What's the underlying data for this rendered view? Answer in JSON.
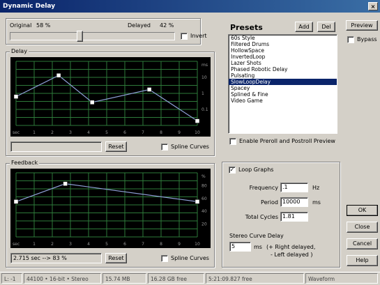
{
  "window": {
    "title": "Dynamic Delay",
    "close_glyph": "×"
  },
  "mix": {
    "original_label": "Original",
    "original_value": "58 %",
    "delayed_label": "Delayed",
    "delayed_value": "42 %",
    "invert_label": "Invert",
    "invert_checked": false,
    "slider_level": 0.42
  },
  "delay": {
    "title": "Delay",
    "reset_label": "Reset",
    "spline_label": "Spline Curves",
    "unit_label": "ms",
    "y_ticks": [
      "10",
      "1",
      "0.1"
    ],
    "x_prefix": "sec",
    "x_ticks": [
      "1",
      "2",
      "3",
      "4",
      "5",
      "6",
      "7",
      "8",
      "9",
      "10"
    ],
    "status_text": ""
  },
  "feedback": {
    "title": "Feedback",
    "reset_label": "Reset",
    "spline_label": "Spline Curves",
    "unit_label": "%",
    "y_ticks": [
      "80",
      "60",
      "40",
      "20"
    ],
    "x_prefix": "sec",
    "x_ticks": [
      "1",
      "2",
      "3",
      "4",
      "5",
      "6",
      "7",
      "8",
      "9",
      "10"
    ],
    "status_text": "2.715 sec --> 83 %"
  },
  "presets": {
    "title": "Presets",
    "add_label": "Add",
    "del_label": "Del",
    "items": [
      "60s Style",
      "Filtered Drums",
      "HollowSpace",
      "InvertedLoop",
      "Lazer Shots",
      "Phased Robotic Delay",
      "Pulsating",
      "SlowLoopDelay",
      "Spacey",
      "Splined & Fine",
      "Video Game"
    ],
    "selected": "SlowLoopDelay",
    "preroll_label": "Enable Preroll and Postroll Preview"
  },
  "side": {
    "preview_label": "Preview",
    "bypass_label": "Bypass",
    "ok_label": "OK",
    "close_label": "Close",
    "cancel_label": "Cancel",
    "help_label": "Help"
  },
  "loop": {
    "loop_graphs_label": "Loop Graphs",
    "loop_graphs_checked": true,
    "check_glyph": "✓",
    "frequency_label": "Frequency",
    "frequency_value": ".1",
    "frequency_unit": "Hz",
    "period_label": "Period",
    "period_value": "10000",
    "period_unit": "ms",
    "cycles_label": "Total Cycles",
    "cycles_value": "1.81",
    "stereo_label": "Stereo Curve Delay",
    "stereo_value": "5",
    "stereo_unit": "ms",
    "stereo_note1": "(+ Right delayed,",
    "stereo_note2": "- Left delayed )"
  },
  "status": [
    "L: -1",
    "44100 • 16-bit • Stereo",
    "15.74 MB",
    "16.28 GB free",
    "5:21:09.827 free",
    "Waveform"
  ],
  "colors": {
    "graph_bg": "#000000",
    "grid": "#2e7a3a",
    "curve": "#8fa0d8",
    "handle": "#ffffff"
  },
  "delay_curve": [
    {
      "t": 0,
      "v": 0.45
    },
    {
      "t": 2.35,
      "v": 0.78
    },
    {
      "t": 4.2,
      "v": 0.36
    },
    {
      "t": 7.35,
      "v": 0.56
    },
    {
      "t": 10,
      "v": 0.07
    }
  ],
  "feedback_curve": [
    {
      "t": 0,
      "v": 0.55
    },
    {
      "t": 2.715,
      "v": 0.83
    },
    {
      "t": 10,
      "v": 0.55
    }
  ]
}
